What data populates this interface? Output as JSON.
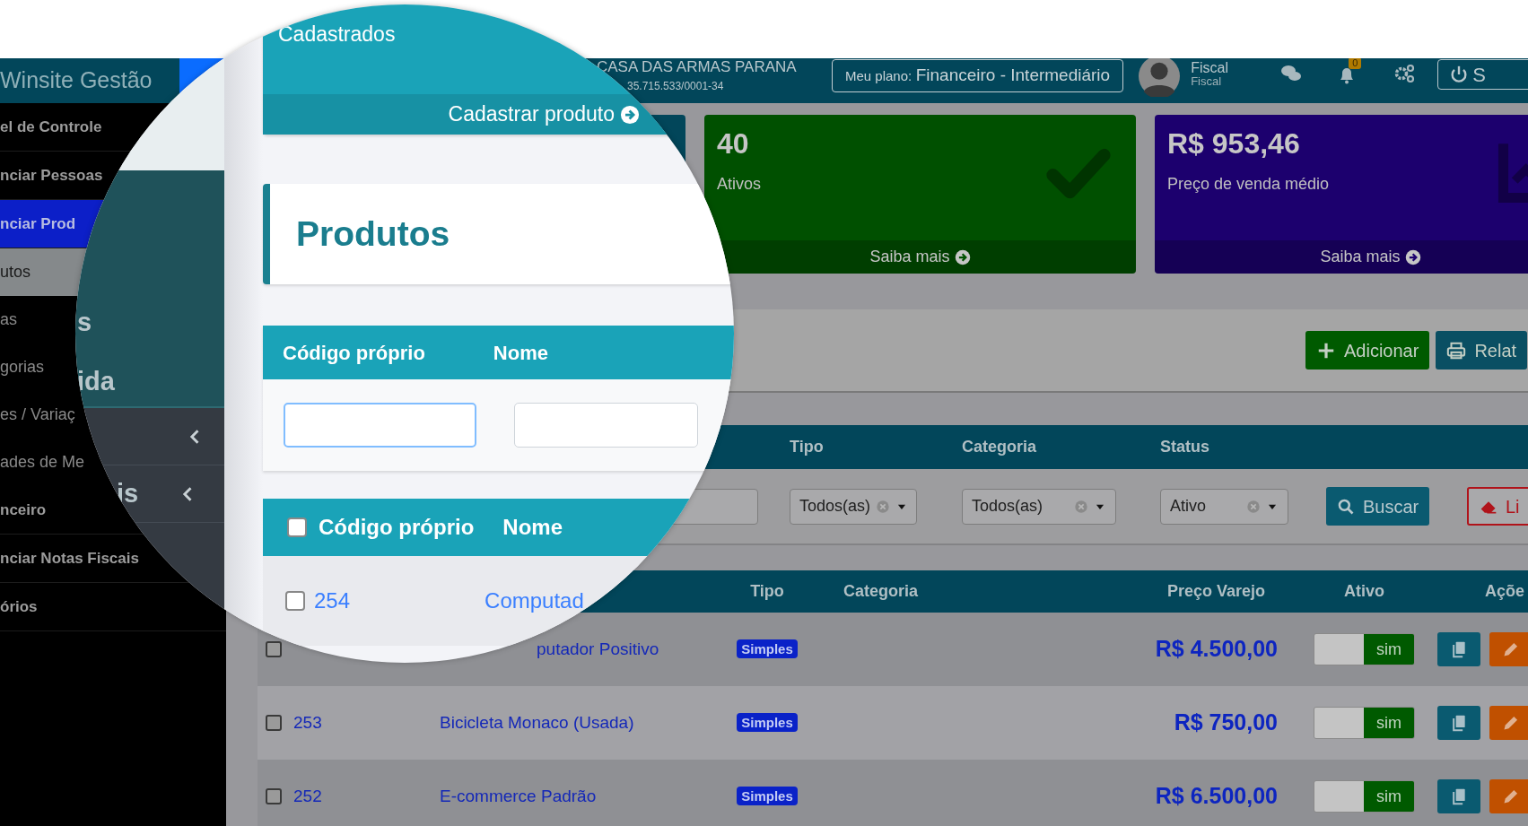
{
  "brand": "Winsite Gestão",
  "sidebar": {
    "items": [
      {
        "label": "el de Controle",
        "selected": false
      },
      {
        "label": "nciar Pessoas",
        "selected": false
      },
      {
        "label": "nciar Prod",
        "selected": true,
        "children": [
          {
            "label": "utos",
            "selected": true
          },
          {
            "label": "as",
            "selected": false
          },
          {
            "label": "gorias",
            "selected": false
          },
          {
            "label": "es / Variaç",
            "selected": false
          },
          {
            "label": "ades de Me",
            "selected": false
          }
        ]
      },
      {
        "label": "nceiro",
        "selected": false
      },
      {
        "label": "nciar Notas Fiscais",
        "selected": false
      },
      {
        "label": "órios",
        "selected": false
      }
    ]
  },
  "header": {
    "company": "CASA DAS ARMAS PARANA",
    "cnpj": "35.715.533/0001-34",
    "plan_label": "Meu plano:",
    "plan": "Financeiro - Intermediário",
    "user_name": "Fiscal",
    "user_role": "Fiscal",
    "notifications": "0",
    "logout": "S"
  },
  "stat_cards": [
    {
      "kind": "plain",
      "color": "#02465a"
    },
    {
      "kind": "check",
      "value": "40",
      "label": "Ativos",
      "link": "Saiba mais",
      "color": "#005000"
    },
    {
      "kind": "chart",
      "value": "R$ 953,46",
      "label": "Preço de venda médio",
      "link": "Saiba mais",
      "color": "#1c006e"
    }
  ],
  "toolbar": {
    "buttons": [
      {
        "kind": "add",
        "label": "Adicionar"
      },
      {
        "kind": "print",
        "label": "Relat"
      }
    ]
  },
  "filters": {
    "columns": [
      "Tipo",
      "Categoria",
      "Status"
    ],
    "selects": [
      {
        "value": "Todos(as)"
      },
      {
        "value": "Todos(as)"
      },
      {
        "value": "Ativo"
      }
    ],
    "search_button": "Buscar",
    "clear_button": "Li"
  },
  "table": {
    "columns": [
      "Tipo",
      "Categoria",
      "Preço Varejo",
      "Ativo",
      "Açõe"
    ],
    "rows": [
      {
        "kind": "covered",
        "checked": false,
        "name": "putador Positivo",
        "type": "Simples",
        "price": "R$ 4.500,00",
        "active": true,
        "active_label": "sim"
      },
      {
        "kind": "plain",
        "checked": false,
        "code": "253",
        "name": "Bicicleta Monaco (Usada)",
        "type": "Simples",
        "price": "R$ 750,00",
        "active": true,
        "active_label": "sim"
      },
      {
        "kind": "plain",
        "checked": false,
        "code": "252",
        "name": "E-commerce Padrão",
        "type": "Simples",
        "price": "R$ 6.500,00",
        "active": true,
        "active_label": "sim"
      }
    ]
  },
  "magnifier": {
    "sidebar_texts": [
      "s",
      "ida",
      "is"
    ],
    "panel_title": "Cadastrados",
    "panel_link": "Cadastrar produto",
    "page_title": "Produtos",
    "filter_columns": [
      "Código próprio",
      "Nome"
    ],
    "table": {
      "select_all_checked": false,
      "columns": [
        "Código próprio",
        "Nome"
      ],
      "rows": [
        {
          "checked": false,
          "code": "254",
          "name": "Computad"
        }
      ]
    }
  }
}
